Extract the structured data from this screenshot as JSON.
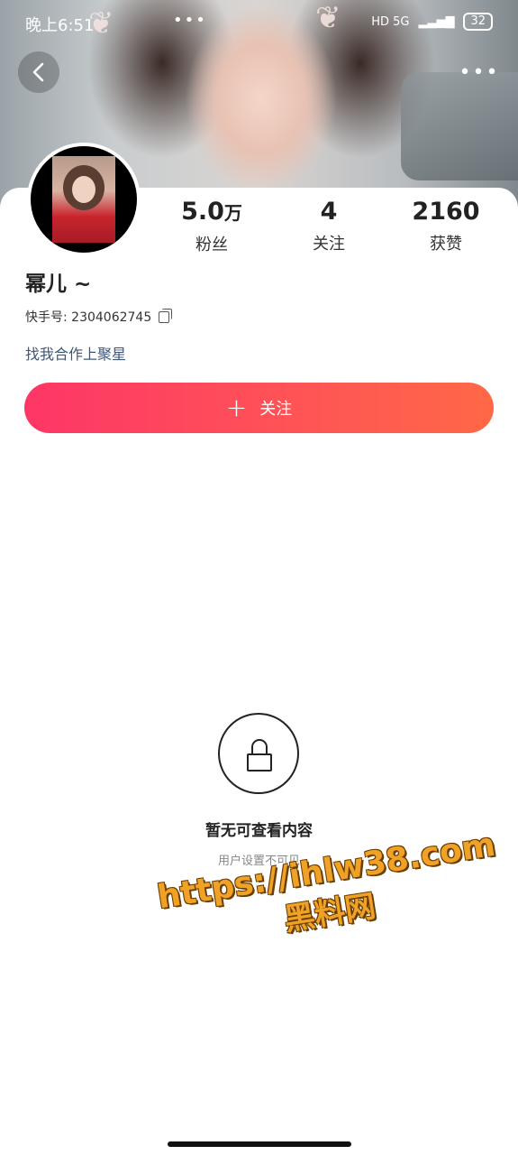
{
  "status_bar": {
    "time": "晚上6:51",
    "dots": "•••",
    "network": "HD 5G",
    "battery": "32"
  },
  "profile": {
    "name": "幂儿 ~",
    "kuaishou_id": "快手号: 2304062745",
    "bio": "找我合作上聚星"
  },
  "stats": [
    {
      "value": "5.0",
      "unit": "万",
      "label": "粉丝"
    },
    {
      "value": "4",
      "unit": "",
      "label": "关注"
    },
    {
      "value": "2160",
      "unit": "",
      "label": "获赞"
    }
  ],
  "follow_button": {
    "label": "关注"
  },
  "empty_state": {
    "title": "暂无可查看内容",
    "subtitle": "用户设置不可见"
  },
  "watermark": {
    "url": "https://ihlw38.com",
    "name": "黑料网"
  },
  "icons": [
    "back-icon",
    "more-icon",
    "copy-icon",
    "plus-icon",
    "lock-icon"
  ],
  "colors": {
    "follow_gradient_start": "#fe3666",
    "follow_gradient_end": "#ff6845",
    "bio_link": "#3f5677"
  }
}
